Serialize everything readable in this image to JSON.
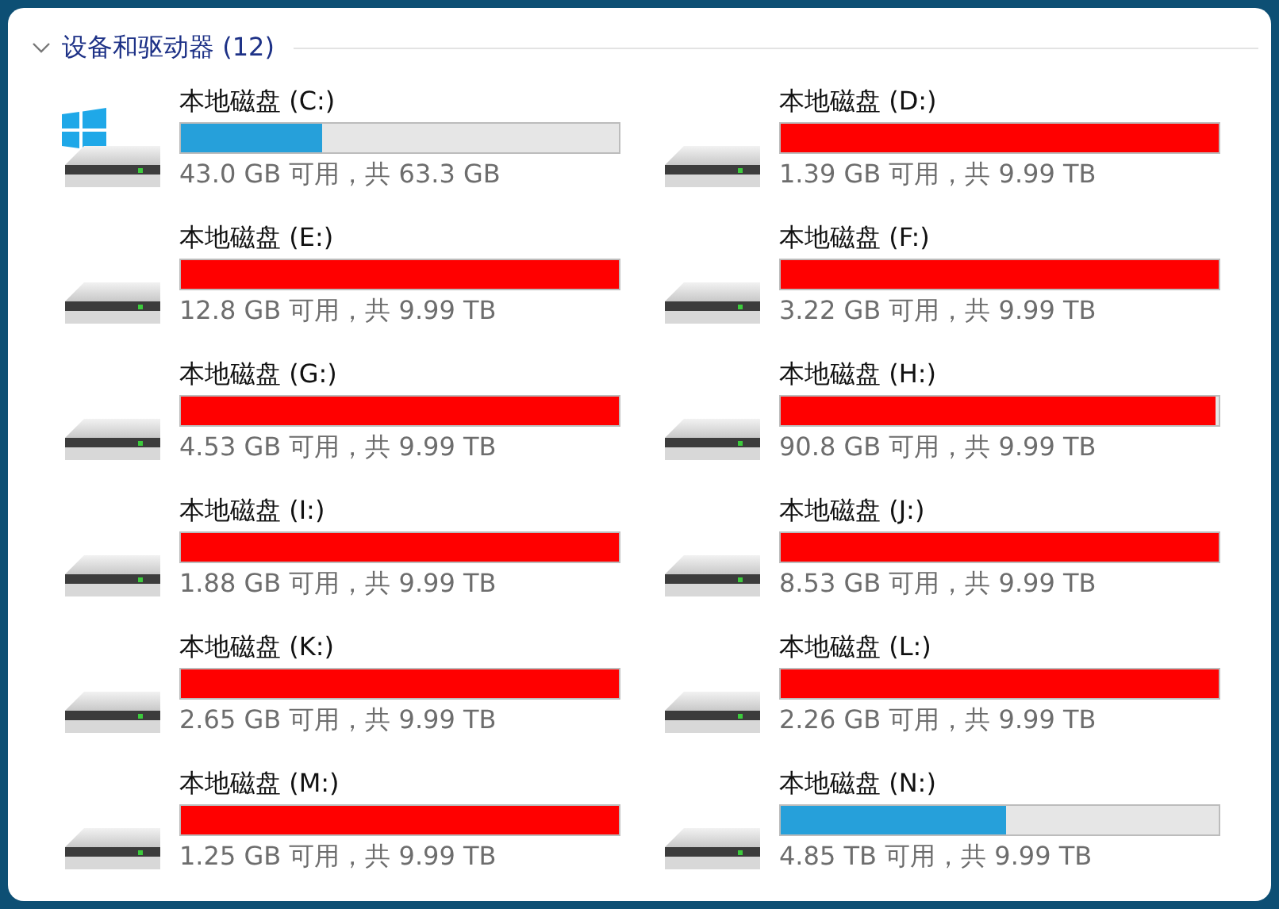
{
  "section": {
    "title": "设备和驱动器 (12)",
    "expanded": true
  },
  "drives": [
    {
      "kind": "system",
      "name": "本地磁盘 (C:)",
      "level": 0.3207,
      "low_space": false,
      "reading": "43.0 GB 可用，共 63.3 GB"
    },
    {
      "kind": "local",
      "name": "本地磁盘 (D:)",
      "level": 0.9999,
      "low_space": true,
      "reading": "1.39 GB 可用，共 9.99 TB"
    },
    {
      "kind": "local",
      "name": "本地磁盘 (E:)",
      "level": 0.9988,
      "low_space": true,
      "reading": "12.8 GB 可用，共 9.99 TB"
    },
    {
      "kind": "local",
      "name": "本地磁盘 (F:)",
      "level": 0.9997,
      "low_space": true,
      "reading": "3.22 GB 可用，共 9.99 TB"
    },
    {
      "kind": "local",
      "name": "本地磁盘 (G:)",
      "level": 0.9996,
      "low_space": true,
      "reading": "4.53 GB 可用，共 9.99 TB"
    },
    {
      "kind": "local",
      "name": "本地磁盘 (H:)",
      "level": 0.9911,
      "low_space": true,
      "reading": "90.8 GB 可用，共 9.99 TB"
    },
    {
      "kind": "local",
      "name": "本地磁盘 (I:)",
      "level": 0.9998,
      "low_space": true,
      "reading": "1.88 GB 可用，共 9.99 TB"
    },
    {
      "kind": "local",
      "name": "本地磁盘 (J:)",
      "level": 0.9992,
      "low_space": true,
      "reading": "8.53 GB 可用，共 9.99 TB"
    },
    {
      "kind": "local",
      "name": "本地磁盘 (K:)",
      "level": 0.9997,
      "low_space": true,
      "reading": "2.65 GB 可用，共 9.99 TB"
    },
    {
      "kind": "local",
      "name": "本地磁盘 (L:)",
      "level": 0.9998,
      "low_space": true,
      "reading": "2.26 GB 可用，共 9.99 TB"
    },
    {
      "kind": "local",
      "name": "本地磁盘 (M:)",
      "level": 0.9999,
      "low_space": true,
      "reading": "1.25 GB 可用，共 9.99 TB"
    },
    {
      "kind": "local",
      "name": "本地磁盘 (N:)",
      "level": 0.5145,
      "low_space": false,
      "reading": "4.85 TB 可用，共 9.99 TB"
    }
  ]
}
